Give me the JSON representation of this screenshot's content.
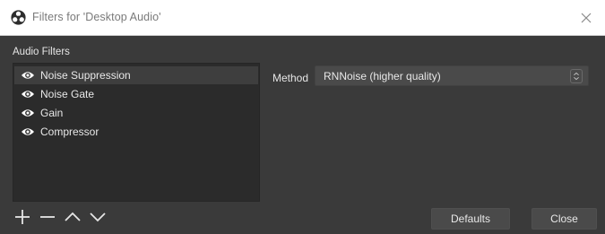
{
  "window": {
    "title": "Filters for 'Desktop Audio'",
    "app_icon": "obs-logo-icon",
    "close_icon": "close-icon"
  },
  "audio_filters": {
    "label": "Audio Filters",
    "items": [
      {
        "label": "Noise Suppression",
        "visible": true,
        "selected": true
      },
      {
        "label": "Noise Gate",
        "visible": true,
        "selected": false
      },
      {
        "label": "Gain",
        "visible": true,
        "selected": false
      },
      {
        "label": "Compressor",
        "visible": true,
        "selected": false
      }
    ]
  },
  "toolbar": {
    "icons": [
      "add-icon",
      "remove-icon",
      "move-up-icon",
      "move-down-icon"
    ]
  },
  "properties": {
    "method_label": "Method",
    "method_value": "RNNoise (higher quality)"
  },
  "buttons": {
    "defaults": "Defaults",
    "close": "Close"
  },
  "colors": {
    "background": "#3a3a3a",
    "list_background": "#2b2b2b",
    "selected_row": "#3e3e3e",
    "control_background": "#4a4a4a",
    "text": "#e6e6e6"
  }
}
